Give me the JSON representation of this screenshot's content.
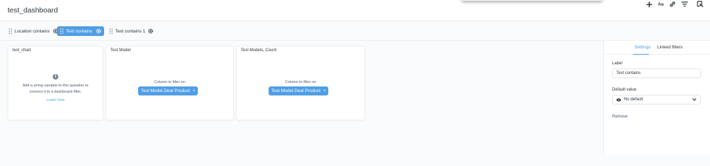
{
  "header": {
    "title": "test_dashboard",
    "tools": [
      {
        "icon": "plus-icon"
      },
      {
        "icon": "text-card-icon",
        "label": "Aa"
      },
      {
        "icon": "link-icon"
      },
      {
        "icon": "filter-icon"
      },
      {
        "icon": "exit-icon"
      }
    ]
  },
  "filters": [
    {
      "label": "Location contains",
      "active": false
    },
    {
      "label": "Text contains",
      "active": true
    },
    {
      "label": "Text contains 1",
      "active": false
    }
  ],
  "cards": [
    {
      "title": "test_chart",
      "info_icon": "i",
      "message": [
        "Add a string variable to this question to",
        "connect it to a dashboard filter."
      ],
      "link": "Learn how"
    },
    {
      "title": "Test Model",
      "column_label": "Column to filter on",
      "pill": "Test Model.Deal Product"
    },
    {
      "title": "Test Models, Count",
      "column_label": "Column to filter on",
      "pill": "Test Model.Deal Product"
    }
  ],
  "pill_close": "×",
  "sidebar": {
    "tabs": [
      "Settings",
      "Linked filters"
    ],
    "label_heading": "Label",
    "label_value": "Text contains",
    "default_heading": "Default value",
    "default_value": "No default",
    "remove": "Remove"
  },
  "colors": {
    "accent": "#509ee3",
    "text": "#2e353b"
  }
}
